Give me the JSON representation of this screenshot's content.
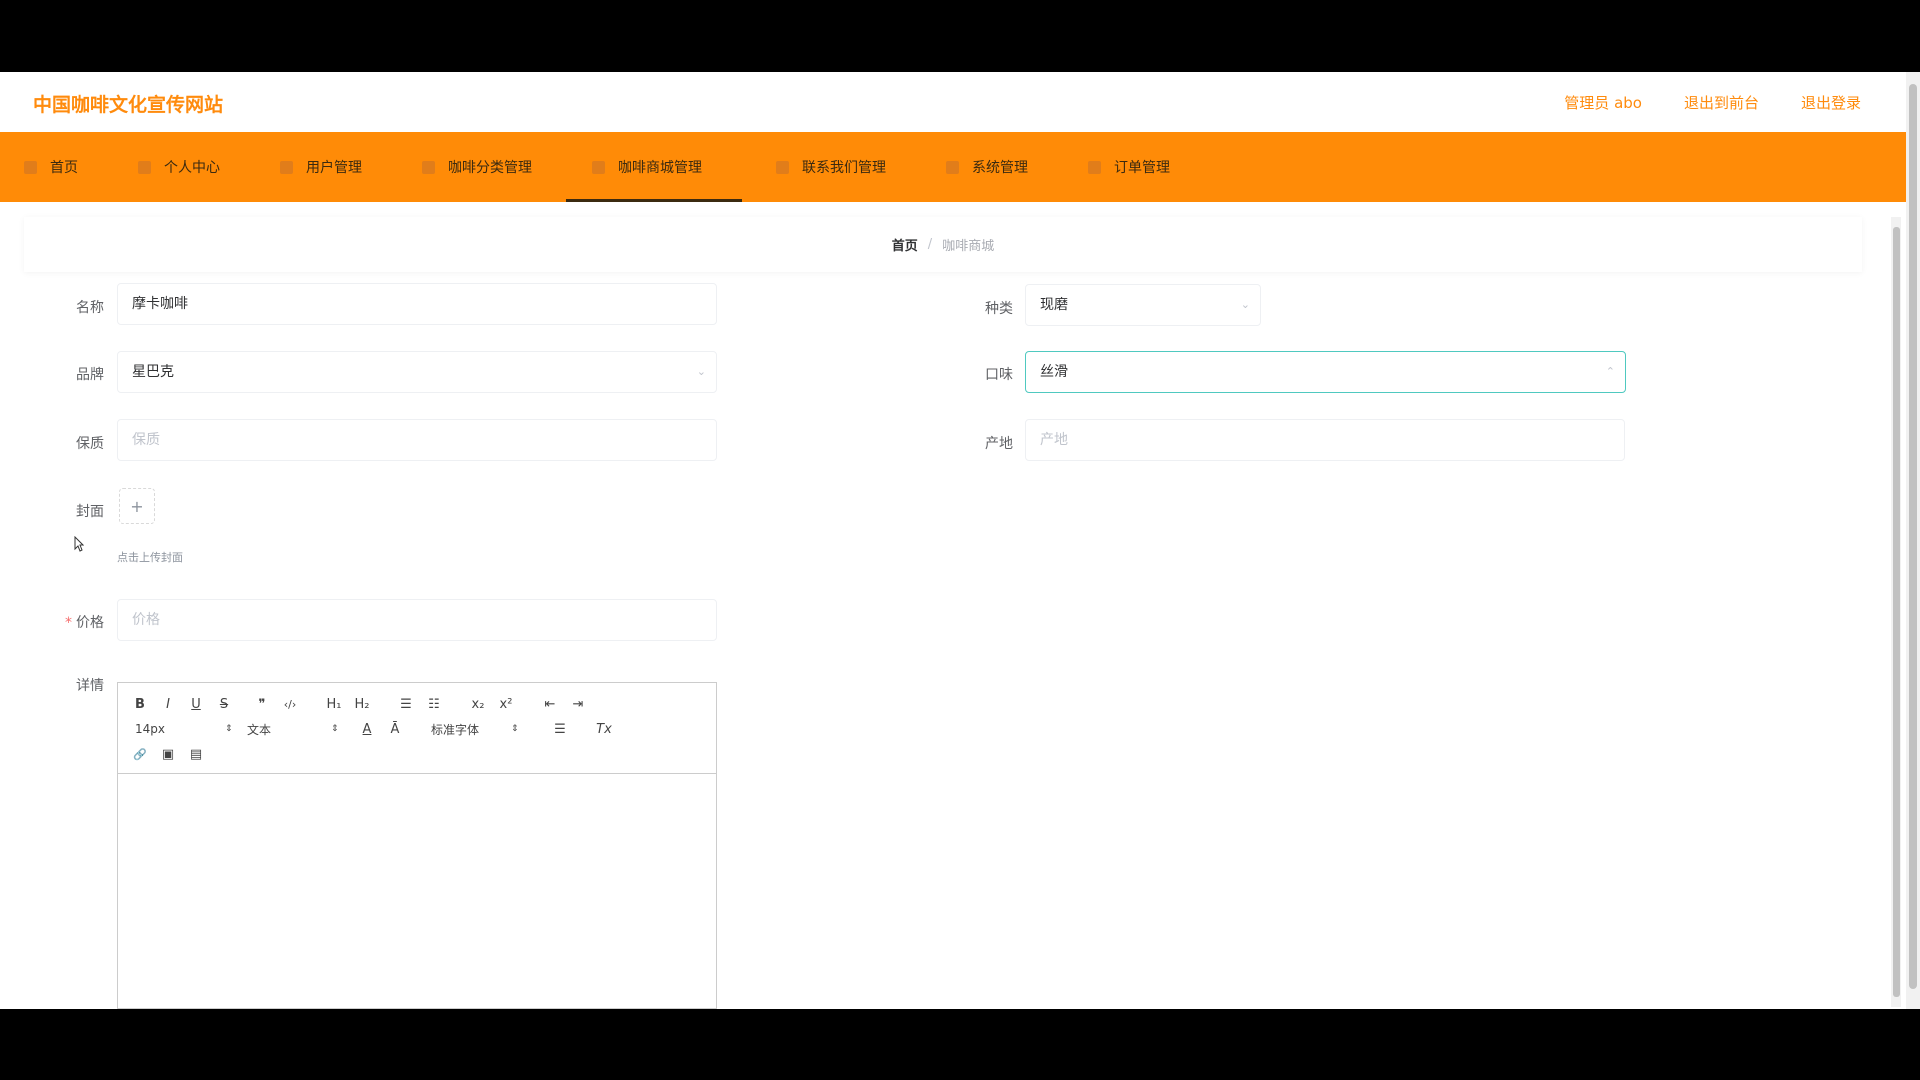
{
  "header": {
    "site_title": "中国咖啡文化宣传网站",
    "admin_label": "管理员 abo",
    "exit_backend": "退出到前台",
    "logout": "退出登录"
  },
  "nav": {
    "items": [
      {
        "label": "首页"
      },
      {
        "label": "个人中心"
      },
      {
        "label": "用户管理"
      },
      {
        "label": "咖啡分类管理"
      },
      {
        "label": "咖啡商城管理",
        "active": true
      },
      {
        "label": "联系我们管理"
      },
      {
        "label": "系统管理"
      },
      {
        "label": "订单管理"
      }
    ]
  },
  "breadcrumb": {
    "home": "首页",
    "separator": "/",
    "current": "咖啡商城"
  },
  "form": {
    "name_label": "名称",
    "name_value": "摩卡咖啡",
    "category_label": "种类",
    "category_value": "现磨",
    "brand_label": "品牌",
    "brand_value": "星巴克",
    "taste_label": "口味",
    "taste_value": "丝滑",
    "shelf_label": "保质",
    "shelf_placeholder": "保质",
    "origin_label": "产地",
    "origin_placeholder": "产地",
    "cover_label": "封面",
    "upload_plus": "+",
    "upload_tip": "点击上传封面",
    "price_required": "*",
    "price_label": "价格",
    "price_placeholder": "价格",
    "detail_label": "详情"
  },
  "editor": {
    "font_size": "14px",
    "paragraph": "文本",
    "font_family": "标准字体",
    "caret": "⇕",
    "bold": "B",
    "italic": "I",
    "underline": "U",
    "strike": "S",
    "quote": "❞",
    "code": "‹/›",
    "h1": "H₁",
    "h2": "H₂",
    "ordered_list": "☰",
    "bullet_list": "☷",
    "subscript": "x₂",
    "superscript": "x²",
    "outdent": "⇤",
    "indent": "⇥",
    "font_color": "A",
    "background": "Ā",
    "align": "☰",
    "clean": "Tx",
    "link": "🔗",
    "image": "▣",
    "video": "▤"
  },
  "colors": {
    "accent": "#ff8b07",
    "title": "#ff8b0d",
    "focus": "#4fc9c0"
  }
}
